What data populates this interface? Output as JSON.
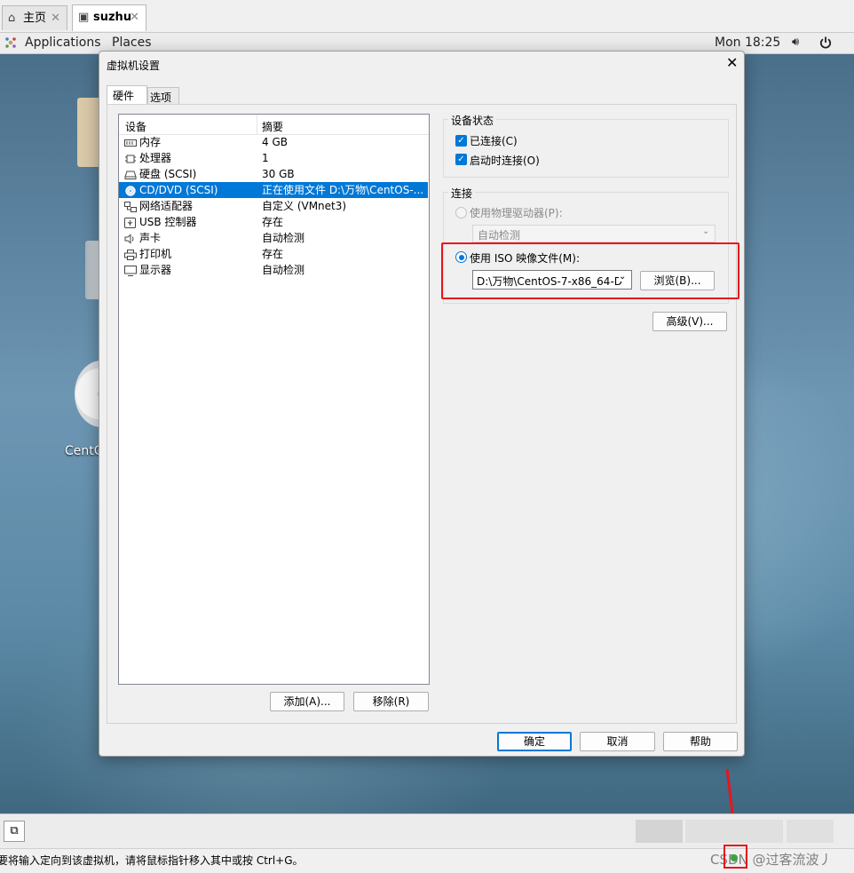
{
  "vmware_tabs": [
    {
      "label": "主页",
      "icon": "home-icon"
    },
    {
      "label": "suzhu",
      "icon": "vm-icon"
    }
  ],
  "gnome_bar": {
    "applications": "Applications",
    "places": "Places",
    "clock": "Mon 18:25"
  },
  "desktop": {
    "iso_label_partial": "CentO"
  },
  "dialog": {
    "title": "虚拟机设置",
    "tabs": [
      "硬件",
      "选项"
    ],
    "device_table": {
      "headers": [
        "设备",
        "摘要"
      ],
      "rows": [
        {
          "device": "内存",
          "summary": "4 GB",
          "icon": "memory-icon"
        },
        {
          "device": "处理器",
          "summary": "1",
          "icon": "cpu-icon"
        },
        {
          "device": "硬盘 (SCSI)",
          "summary": "30 GB",
          "icon": "harddisk-icon"
        },
        {
          "device": "CD/DVD (SCSI)",
          "summary": "正在使用文件 D:\\万物\\CentOS-...",
          "icon": "cd-icon",
          "selected": true
        },
        {
          "device": "网络适配器",
          "summary": "自定义 (VMnet3)",
          "icon": "network-icon"
        },
        {
          "device": "USB 控制器",
          "summary": "存在",
          "icon": "usb-icon"
        },
        {
          "device": "声卡",
          "summary": "自动检测",
          "icon": "speaker-icon"
        },
        {
          "device": "打印机",
          "summary": "存在",
          "icon": "printer-icon"
        },
        {
          "device": "显示器",
          "summary": "自动检测",
          "icon": "monitor-icon"
        }
      ]
    },
    "add_button": "添加(A)...",
    "remove_button": "移除(R)",
    "device_status": {
      "title": "设备状态",
      "connected": "已连接(C)",
      "connect_on_power": "启动时连接(O)"
    },
    "connection": {
      "title": "连接",
      "use_physical": "使用物理驱动器(P):",
      "physical_value": "自动检测",
      "use_iso": "使用 ISO 映像文件(M):",
      "iso_path": "D:\\万物\\CentOS-7-x86_64-D",
      "browse_button": "浏览(B)..."
    },
    "advanced_button": "高级(V)...",
    "ok_button": "确定",
    "cancel_button": "取消",
    "help_button": "帮助"
  },
  "status_bar": {
    "message": "要将输入定向到该虚拟机，请将鼠标指针移入其中或按 Ctrl+G。",
    "watermark": "CSDN @过客流波丿"
  },
  "colors": {
    "selection": "#0078d7",
    "highlight_box": "#e8151b"
  }
}
